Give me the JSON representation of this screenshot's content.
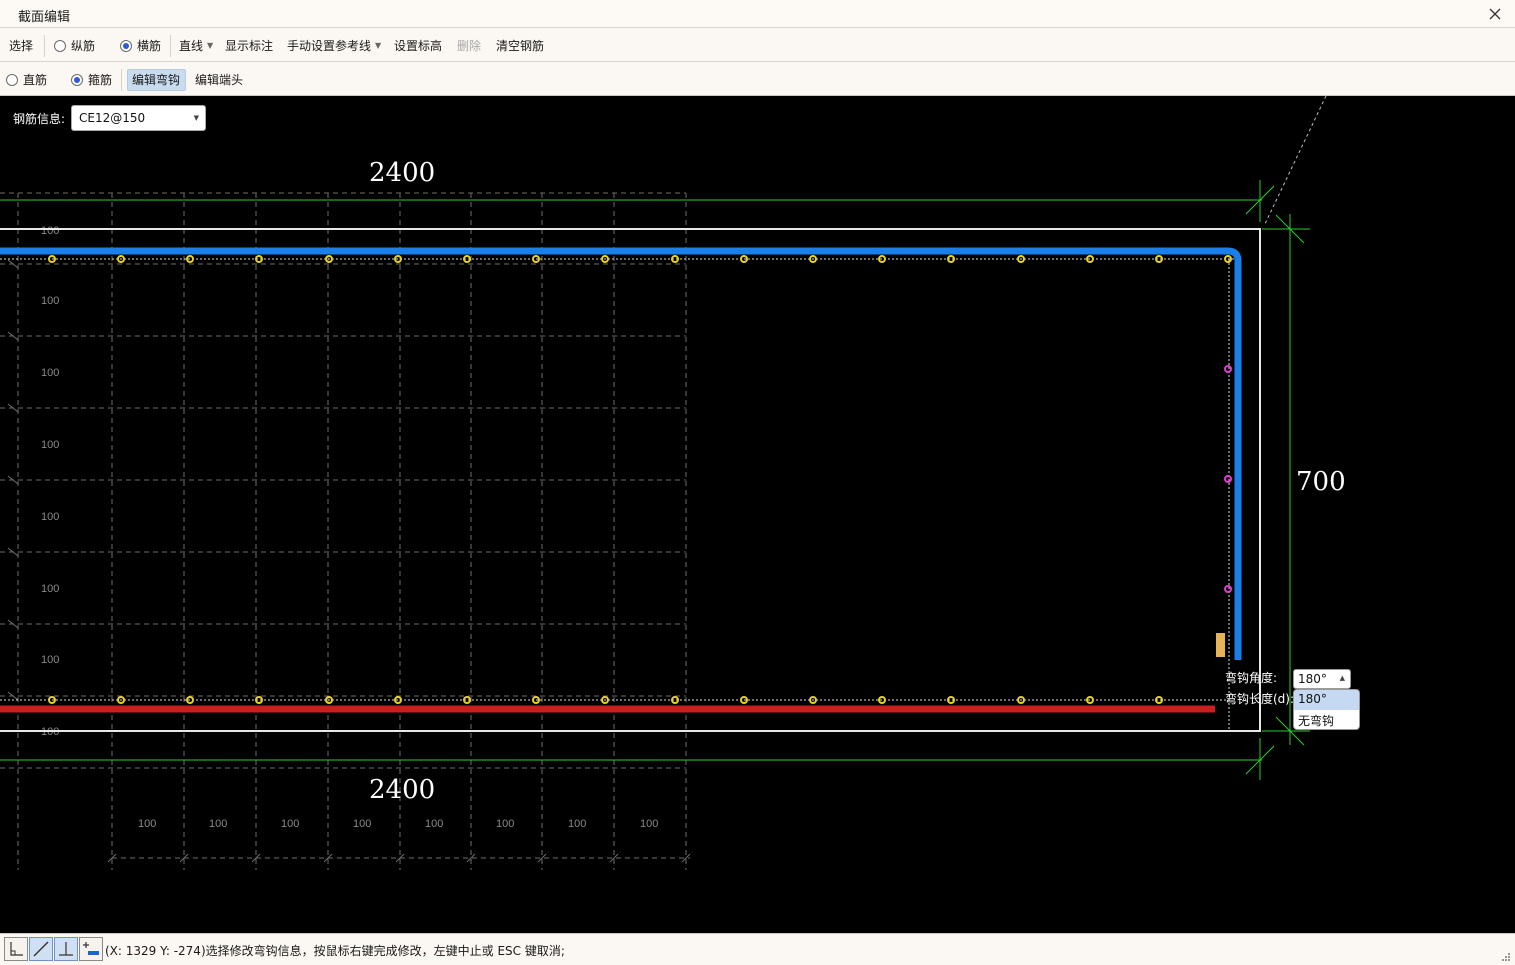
{
  "window": {
    "title": "截面编辑"
  },
  "toolbar1": {
    "select": "选择",
    "longitudinal": "纵筋",
    "transverse": "横筋",
    "line": "直线",
    "show_dims": "显示标注",
    "manual_ref": "手动设置参考线",
    "set_elev": "设置标高",
    "delete": "删除",
    "clear_rebar": "清空钢筋"
  },
  "toolbar2": {
    "straight": "直筋",
    "stirrup": "箍筋",
    "edit_hook": "编辑弯钩",
    "edit_end": "编辑端头"
  },
  "rebar_info": {
    "label": "钢筋信息:",
    "value": "CE12@150"
  },
  "drawing": {
    "top_dim": "2400",
    "bottom_dim": "2400",
    "right_dim": "700",
    "row_spacing_label": "100",
    "col_spacing_label": "100"
  },
  "hook_editor": {
    "angle_label": "弯钩角度:",
    "length_label": "弯钩长度(d):",
    "angle_value": "180°",
    "options": [
      "180°",
      "无弯钩"
    ]
  },
  "status": {
    "text": "(X: 1329 Y: -274)选择修改弯钩信息，按鼠标右键完成修改，左键中止或 ESC 键取消;"
  },
  "colors": {
    "canvas_bg": "#000000",
    "stirrup": "#1a7fe8",
    "bottom_bar": "#c81e1e",
    "points": "#e8d21a",
    "magenta_points": "#e23bd2",
    "dim_lines": "#2ecc2e",
    "hook_marker": "#e6b35a"
  },
  "icons": [
    "close-icon",
    "dropdown-arrow-icon",
    "ortho-icon",
    "line-snap-icon",
    "perpendicular-icon",
    "add-point-icon",
    "resize-grip-icon"
  ]
}
